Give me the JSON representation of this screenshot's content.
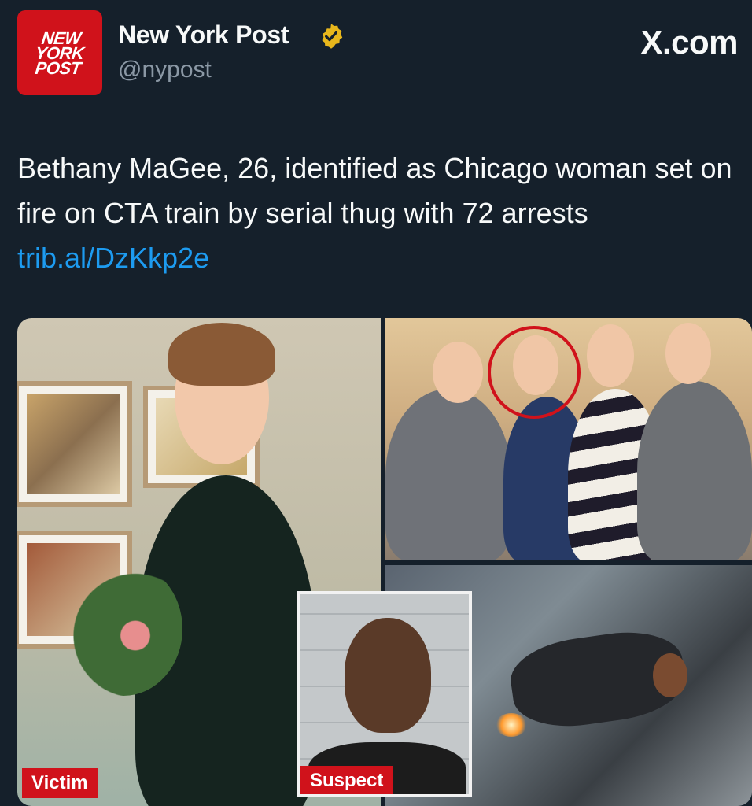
{
  "profile": {
    "avatar_text": "NEW\nYORK\nPOST",
    "display_name": "New York Post",
    "handle": "@nypost",
    "verified_icon": "verified-badge-icon",
    "verified_color": "#e8b71c"
  },
  "watermark": "X.com",
  "tweet": {
    "text": "Bethany MaGee, 26, identified as Chicago woman set on fire on CTA train by serial thug with 72 arrests",
    "link": "trib.al/DzKkp2e"
  },
  "media": {
    "victim_label": "Victim",
    "suspect_label": "Suspect",
    "label_color": "#d0121b"
  },
  "colors": {
    "background": "#15202b",
    "link": "#1d9bf0",
    "brand": "#d0121b"
  }
}
